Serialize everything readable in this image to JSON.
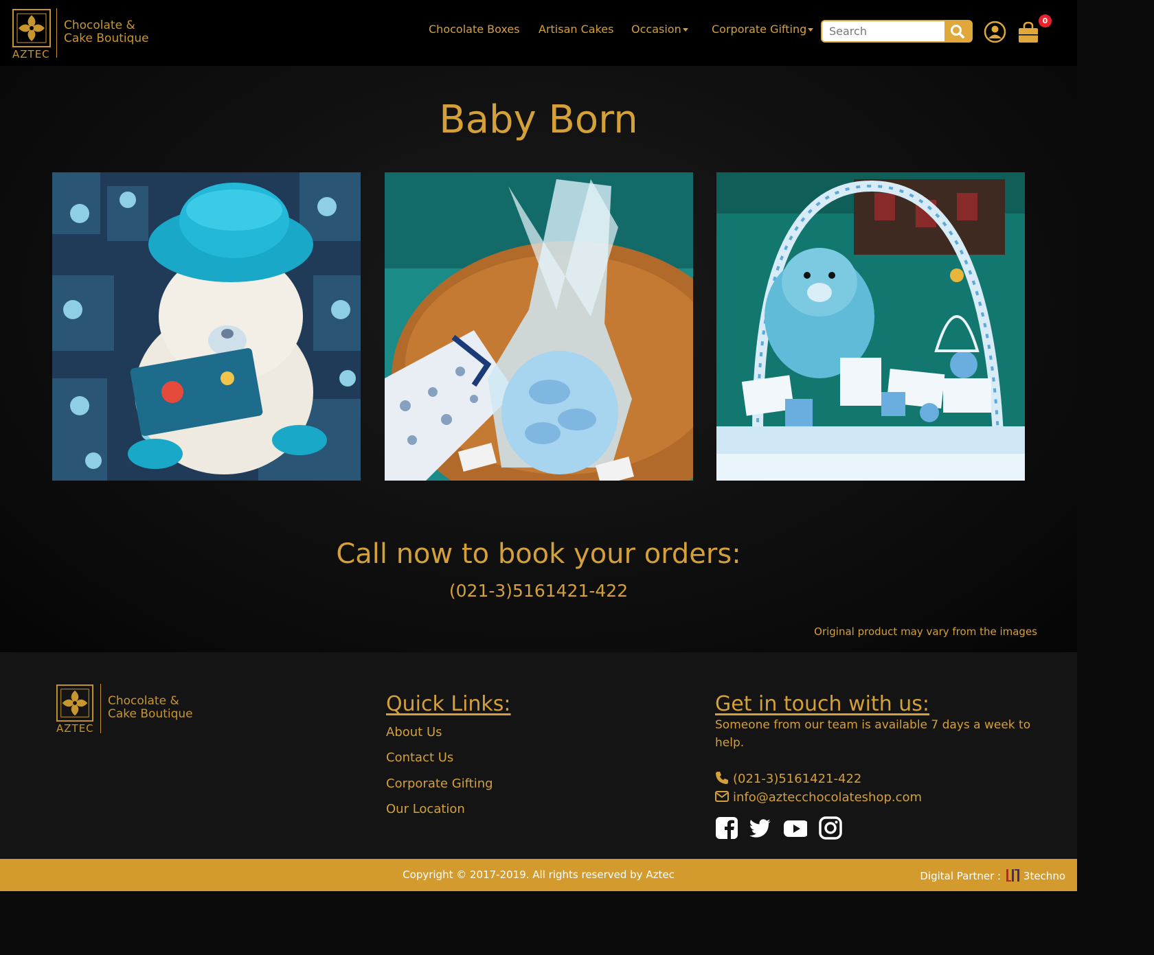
{
  "brand": {
    "name": "AZTEC",
    "tagline_line1": "Chocolate &",
    "tagline_line2": "Cake Boutique"
  },
  "nav": {
    "items": [
      {
        "label": "Chocolate Boxes",
        "dropdown": false
      },
      {
        "label": "Artisan Cakes",
        "dropdown": false
      },
      {
        "label": "Occasion",
        "dropdown": true
      },
      {
        "label": "Corporate Gifting",
        "dropdown": true
      }
    ],
    "search_placeholder": "Search",
    "cart_count": "0"
  },
  "page": {
    "title": "Baby Born",
    "gallery": [
      {
        "icon": "teddy-bear-blue-hat-photo"
      },
      {
        "icon": "gift-basket-cellophane-photo"
      },
      {
        "icon": "baby-boy-gift-tray-photo"
      }
    ],
    "cta_title": "Call now to book your orders:",
    "cta_phone": "(021-3)5161421-422",
    "disclaimer": "Original product may vary from the images"
  },
  "footer": {
    "quick_links_heading": "Quick Links:",
    "quick_links": [
      "About Us",
      "Contact Us",
      "Corporate Gifting",
      "Our Location"
    ],
    "contact_heading": "Get in touch with us:",
    "contact_text": "Someone from our team is available 7 days a week to help.",
    "phone": "(021-3)5161421-422",
    "email": "info@aztecchocolateshop.com",
    "social": [
      "facebook-icon",
      "twitter-icon",
      "youtube-icon",
      "instagram-icon"
    ]
  },
  "copyright": {
    "text": "Copyright © 2017-2019. All rights reserved by Aztec",
    "partner_label": "Digital Partner :",
    "partner_name": "3techno"
  },
  "colors": {
    "accent": "#d4a03a",
    "header_bg": "#000000",
    "copyright_bg": "#d39a2e",
    "badge": "#e8232b"
  }
}
